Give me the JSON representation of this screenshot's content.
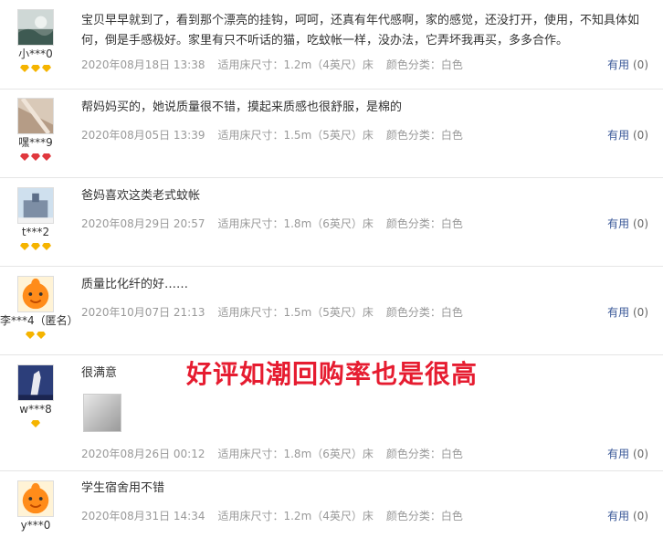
{
  "reviews": [
    {
      "username": "小***0",
      "text": "宝贝早早就到了，看到那个漂亮的挂钩，呵呵，还真有年代感啊，家的感觉，还没打开，使用，不知具体如何，倒是手感极好。家里有只不听话的猫，吃蚊帐一样，没办法，它弄坏我再买，多多合作。",
      "date": "2020年08月18日 13:38",
      "size": "适用床尺寸：1.2m（4英尺）床",
      "color": "颜色分类：白色",
      "useful_label": "有用",
      "useful_count": "(0)",
      "badge": "gold"
    },
    {
      "username": "嘿***9",
      "text": "帮妈妈买的，她说质量很不错，摸起来质感也很舒服，是棉的",
      "date": "2020年08月05日 13:39",
      "size": "适用床尺寸：1.5m（5英尺）床",
      "color": "颜色分类：白色",
      "useful_label": "有用",
      "useful_count": "(0)",
      "badge": "red"
    },
    {
      "username": "t***2",
      "text": "爸妈喜欢这类老式蚊帐",
      "date": "2020年08月29日 20:57",
      "size": "适用床尺寸：1.8m（6英尺）床",
      "color": "颜色分类：白色",
      "useful_label": "有用",
      "useful_count": "(0)",
      "badge": "gold"
    },
    {
      "username": "李***4（匿名）",
      "text": "质量比化纤的好……",
      "date": "2020年10月07日 21:13",
      "size": "适用床尺寸：1.5m（5英尺）床",
      "color": "颜色分类：白色",
      "useful_label": "有用",
      "useful_count": "(0)",
      "badge": "gold"
    },
    {
      "username": "w***8",
      "text": "很满意",
      "date": "2020年08月26日 00:12",
      "size": "适用床尺寸：1.8m（6英尺）床",
      "color": "颜色分类：白色",
      "useful_label": "有用",
      "useful_count": "(0)",
      "badge": "gold"
    },
    {
      "username": "y***0",
      "text": "学生宿舍用不错",
      "date": "2020年08月31日 14:34",
      "size": "适用床尺寸：1.2m（4英尺）床",
      "color": "颜色分类：白色",
      "useful_label": "有用",
      "useful_count": "(0)",
      "badge": "gold"
    }
  ],
  "overlay_text": "好评如潮回购率也是很高",
  "colors": {
    "accent_red": "#e61c30",
    "link_blue": "#3b5998",
    "meta_gray": "#999999",
    "badge_gold": "#f5b400",
    "badge_red": "#e0383e"
  }
}
